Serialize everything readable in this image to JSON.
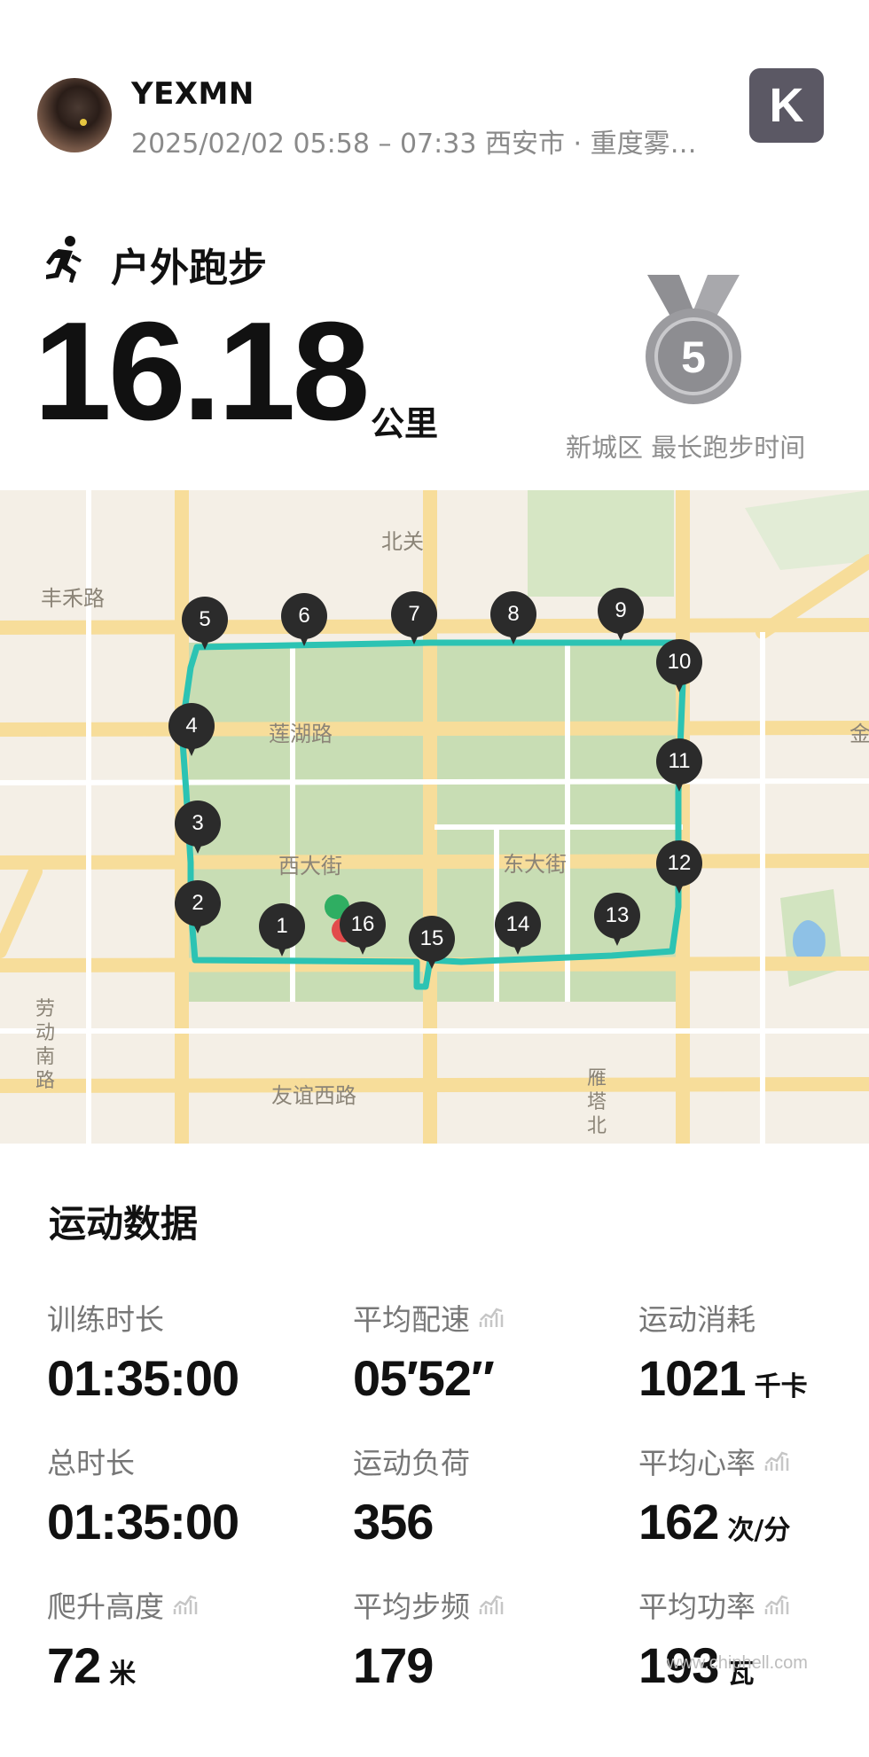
{
  "header": {
    "username": "YEXMN",
    "meta": "2025/02/02 05:58 – 07:33 西安市 · 重度雾…",
    "app_logo_letter": "K"
  },
  "activity": {
    "type": "户外跑步",
    "distance": "16.18",
    "distance_unit": "公里",
    "medal_number": "5",
    "medal_caption": "新城区 最长跑步时间"
  },
  "map": {
    "labels": {
      "beiguan": "北关",
      "fenghe": "丰禾路",
      "lianhu": "莲湖路",
      "xidajie": "西大街",
      "dongdajie": "东大街",
      "youyi": "友谊西路",
      "jin": "金",
      "laodong": [
        "劳",
        "动",
        "南",
        "路"
      ],
      "yanta": [
        "雁",
        "塔",
        "北"
      ]
    },
    "pins": [
      "1",
      "2",
      "3",
      "4",
      "5",
      "6",
      "7",
      "8",
      "9",
      "10",
      "11",
      "12",
      "13",
      "14",
      "15",
      "16"
    ]
  },
  "stats_title": "运动数据",
  "stats": [
    {
      "label": "训练时长",
      "value": "01:35:00",
      "unit": "",
      "trend": false
    },
    {
      "label": "平均配速",
      "value": "05′52″",
      "unit": "",
      "trend": true
    },
    {
      "label": "运动消耗",
      "value": "1021",
      "unit": "千卡",
      "trend": false
    },
    {
      "label": "总时长",
      "value": "01:35:00",
      "unit": "",
      "trend": false
    },
    {
      "label": "运动负荷",
      "value": "356",
      "unit": "",
      "trend": false
    },
    {
      "label": "平均心率",
      "value": "162",
      "unit": "次/分",
      "trend": true
    },
    {
      "label": "爬升高度",
      "value": "72",
      "unit": "米",
      "trend": true
    },
    {
      "label": "平均步频",
      "value": "179",
      "unit": "",
      "trend": true
    },
    {
      "label": "平均功率",
      "value": "193",
      "unit": "瓦",
      "trend": true
    }
  ],
  "watermark": {
    "url": "www.chiphell.com",
    "logo": "chiphell"
  },
  "colors": {
    "route": "#2cc3b3",
    "park_green": "#c8ddb4",
    "road_yellow": "#f7dd9a",
    "pin_dark": "#2b2b2b"
  }
}
